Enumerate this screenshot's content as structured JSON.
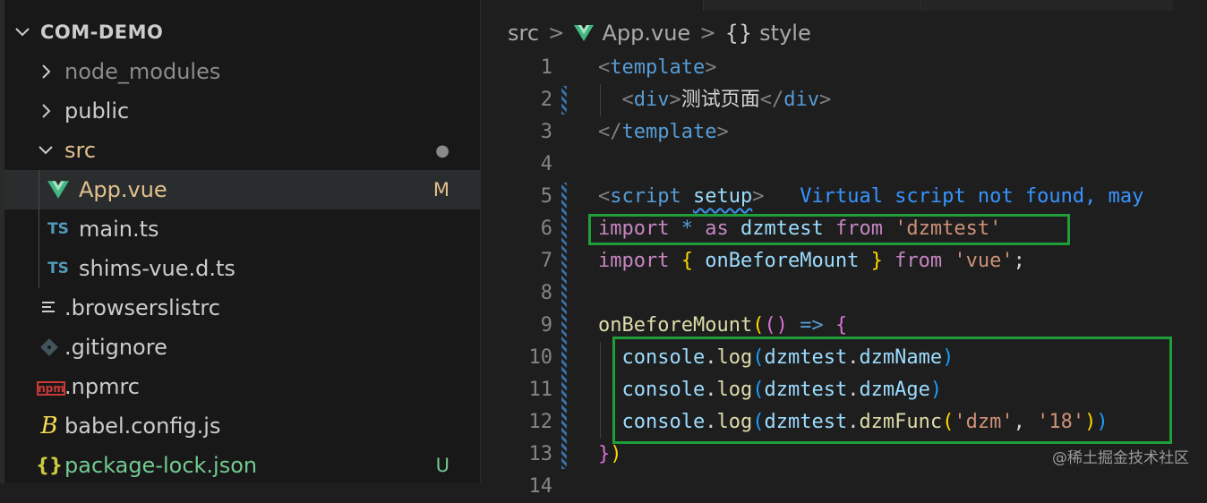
{
  "explorer": {
    "root": "COM-DEMO",
    "items": [
      {
        "label": "node_modules",
        "kind": "folder",
        "icon": "chevron-right-icon",
        "status": "",
        "color": "#8b8b8b"
      },
      {
        "label": "public",
        "kind": "folder",
        "icon": "chevron-right-icon",
        "status": "",
        "color": "#cccccc"
      },
      {
        "label": "src",
        "kind": "folder-open",
        "icon": "chevron-down-icon",
        "status": "●",
        "color": "#e2c08d"
      },
      {
        "label": "App.vue",
        "kind": "vue-file",
        "icon": "vue-icon",
        "status": "M",
        "color": "#e2c08d"
      },
      {
        "label": "main.ts",
        "kind": "ts-file",
        "icon": "ts-icon",
        "status": "",
        "color": "#cccccc"
      },
      {
        "label": "shims-vue.d.ts",
        "kind": "ts-file",
        "icon": "ts-icon",
        "status": "",
        "color": "#cccccc"
      },
      {
        "label": ".browserslistrc",
        "kind": "file",
        "icon": "lines-icon",
        "status": "",
        "color": "#cccccc"
      },
      {
        "label": ".gitignore",
        "kind": "file",
        "icon": "git-icon",
        "status": "",
        "color": "#cccccc"
      },
      {
        "label": ".npmrc",
        "kind": "file",
        "icon": "npm-icon",
        "status": "",
        "color": "#cccccc"
      },
      {
        "label": "babel.config.js",
        "kind": "file",
        "icon": "babel-icon",
        "status": "",
        "color": "#cccccc"
      },
      {
        "label": "package-lock.json",
        "kind": "file",
        "icon": "json-icon",
        "status": "U",
        "color": "#73c991"
      }
    ],
    "ts_badge": "TS",
    "json_badge": "{}",
    "npm_badge": "npm"
  },
  "breadcrumb": {
    "folder": "src",
    "sep": ">",
    "file": "App.vue",
    "symbol_icon": "{}",
    "symbol": "style"
  },
  "editor": {
    "lines": [
      {
        "n": "1",
        "tokens": [
          [
            "tk-punc",
            "<"
          ],
          [
            "tk-tag",
            "template"
          ],
          [
            "tk-punc",
            ">"
          ]
        ]
      },
      {
        "n": "2",
        "tokens": [
          [
            "tk-plain",
            "  "
          ],
          [
            "tk-punc",
            "<"
          ],
          [
            "tk-tag",
            "div"
          ],
          [
            "tk-punc",
            ">"
          ],
          [
            "tk-text",
            "测试页面"
          ],
          [
            "tk-punc",
            "</"
          ],
          [
            "tk-tag",
            "div"
          ],
          [
            "tk-punc",
            ">"
          ]
        ]
      },
      {
        "n": "3",
        "tokens": [
          [
            "tk-punc",
            "</"
          ],
          [
            "tk-tag",
            "template"
          ],
          [
            "tk-punc",
            ">"
          ]
        ]
      },
      {
        "n": "4",
        "tokens": []
      },
      {
        "n": "5",
        "tokens": [
          [
            "tk-punc",
            "<"
          ],
          [
            "tk-tag",
            "script"
          ],
          [
            "tk-plain",
            " "
          ],
          [
            "tk-attr",
            "setup"
          ],
          [
            "tk-punc",
            ">"
          ],
          [
            "tk-plain",
            "   "
          ],
          [
            "tk-virtual",
            "Virtual script not found, may"
          ]
        ]
      },
      {
        "n": "6",
        "tokens": [
          [
            "tk-kw",
            "import"
          ],
          [
            "tk-plain",
            " "
          ],
          [
            "tk-tag",
            "*"
          ],
          [
            "tk-plain",
            " "
          ],
          [
            "tk-kw",
            "as"
          ],
          [
            "tk-plain",
            " "
          ],
          [
            "tk-var",
            "dzmtest"
          ],
          [
            "tk-plain",
            " "
          ],
          [
            "tk-kw",
            "from"
          ],
          [
            "tk-plain",
            " "
          ],
          [
            "tk-str",
            "'dzmtest'"
          ]
        ]
      },
      {
        "n": "7",
        "tokens": [
          [
            "tk-kw",
            "import"
          ],
          [
            "tk-plain",
            " "
          ],
          [
            "tk-brace1",
            "{"
          ],
          [
            "tk-plain",
            " "
          ],
          [
            "tk-var",
            "onBeforeMount"
          ],
          [
            "tk-plain",
            " "
          ],
          [
            "tk-brace1",
            "}"
          ],
          [
            "tk-plain",
            " "
          ],
          [
            "tk-kw",
            "from"
          ],
          [
            "tk-plain",
            " "
          ],
          [
            "tk-str",
            "'vue'"
          ],
          [
            "tk-plain",
            ";"
          ]
        ]
      },
      {
        "n": "8",
        "tokens": []
      },
      {
        "n": "9",
        "tokens": [
          [
            "tk-fn",
            "onBeforeMount"
          ],
          [
            "tk-brace1",
            "("
          ],
          [
            "tk-brace2",
            "()"
          ],
          [
            "tk-plain",
            " "
          ],
          [
            "tk-tag",
            "=>"
          ],
          [
            "tk-plain",
            " "
          ],
          [
            "tk-brace2",
            "{"
          ]
        ]
      },
      {
        "n": "10",
        "tokens": [
          [
            "tk-plain",
            "  "
          ],
          [
            "tk-var",
            "console"
          ],
          [
            "tk-plain",
            "."
          ],
          [
            "tk-fn",
            "log"
          ],
          [
            "tk-brace3",
            "("
          ],
          [
            "tk-var",
            "dzmtest"
          ],
          [
            "tk-plain",
            "."
          ],
          [
            "tk-var",
            "dzmName"
          ],
          [
            "tk-brace3",
            ")"
          ]
        ]
      },
      {
        "n": "11",
        "tokens": [
          [
            "tk-plain",
            "  "
          ],
          [
            "tk-var",
            "console"
          ],
          [
            "tk-plain",
            "."
          ],
          [
            "tk-fn",
            "log"
          ],
          [
            "tk-brace3",
            "("
          ],
          [
            "tk-var",
            "dzmtest"
          ],
          [
            "tk-plain",
            "."
          ],
          [
            "tk-var",
            "dzmAge"
          ],
          [
            "tk-brace3",
            ")"
          ]
        ]
      },
      {
        "n": "12",
        "tokens": [
          [
            "tk-plain",
            "  "
          ],
          [
            "tk-var",
            "console"
          ],
          [
            "tk-plain",
            "."
          ],
          [
            "tk-fn",
            "log"
          ],
          [
            "tk-brace3",
            "("
          ],
          [
            "tk-var",
            "dzmtest"
          ],
          [
            "tk-plain",
            "."
          ],
          [
            "tk-fn",
            "dzmFunc"
          ],
          [
            "tk-brace1",
            "("
          ],
          [
            "tk-str",
            "'dzm'"
          ],
          [
            "tk-plain",
            ", "
          ],
          [
            "tk-str",
            "'18'"
          ],
          [
            "tk-brace1",
            ")"
          ],
          [
            "tk-brace3",
            ")"
          ]
        ]
      },
      {
        "n": "13",
        "tokens": [
          [
            "tk-brace2",
            "}"
          ],
          [
            "tk-brace1",
            ")"
          ]
        ]
      },
      {
        "n": "14",
        "tokens": []
      }
    ]
  },
  "watermark": "@稀土掘金技术社区",
  "colors": {
    "highlight_box": "#1f9e3a",
    "modified": "#e2c08d",
    "untracked": "#73c991"
  }
}
